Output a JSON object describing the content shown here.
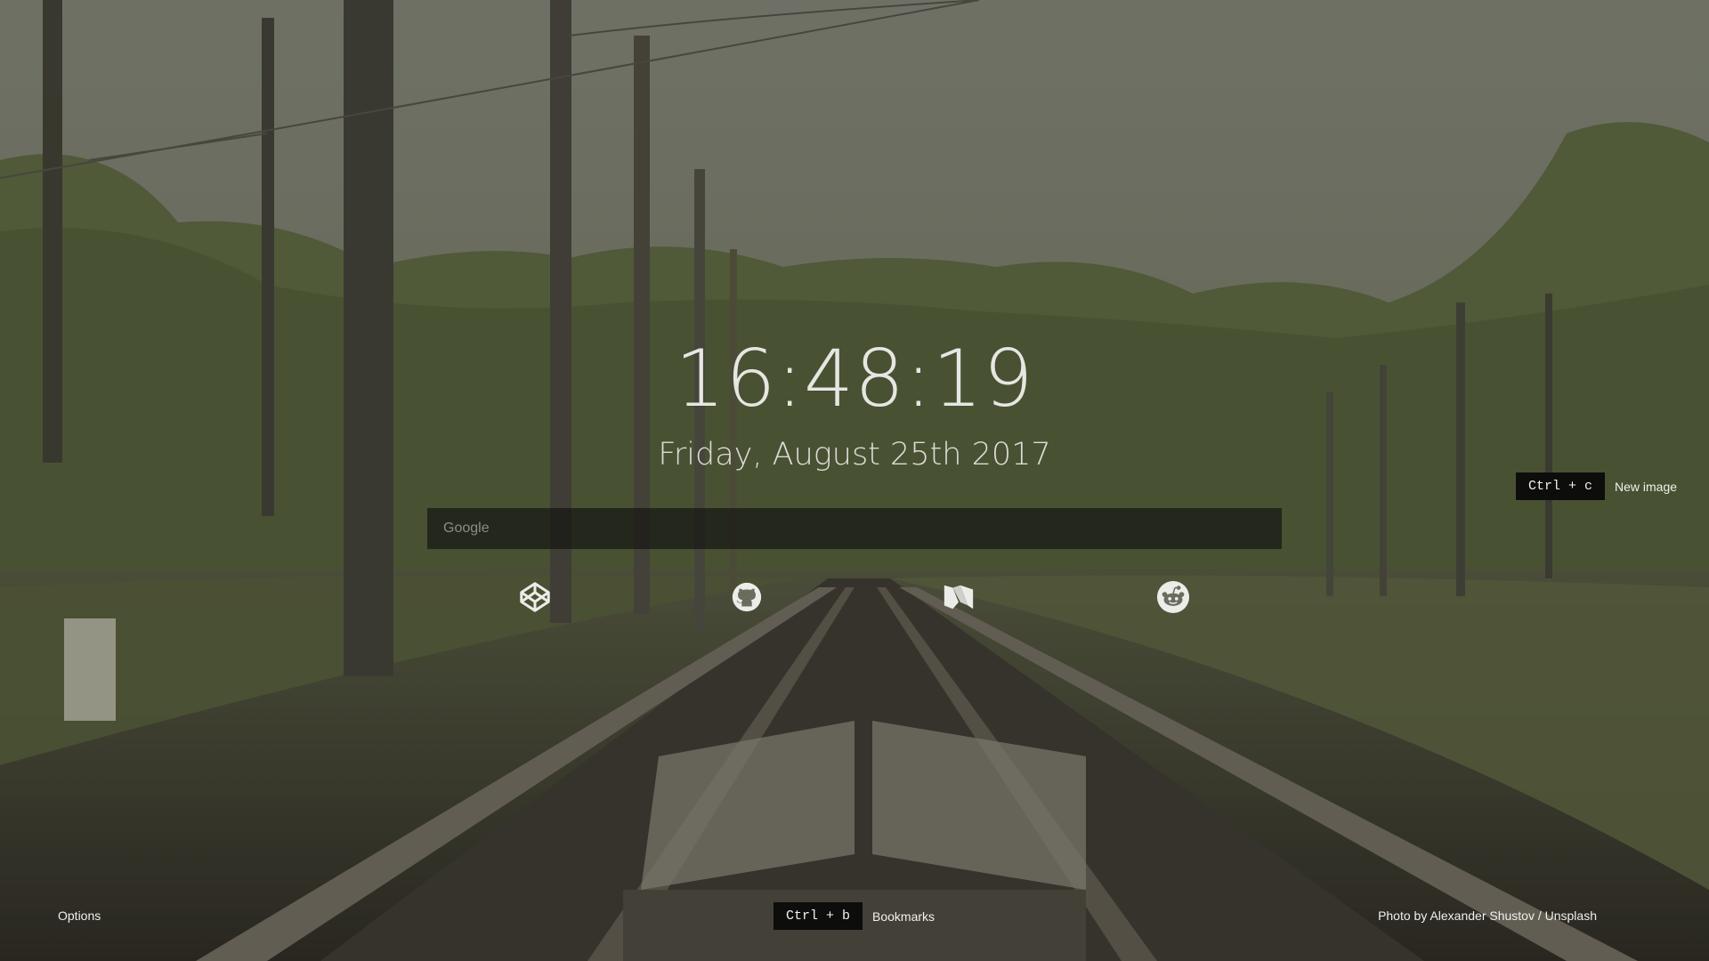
{
  "clock": {
    "time": "16:48:19",
    "date": "Friday, August 25th 2017"
  },
  "search": {
    "placeholder": "Google",
    "value": ""
  },
  "bookmarks": [
    {
      "name": "CodePen",
      "icon": "codepen-icon"
    },
    {
      "name": "GitHub",
      "icon": "github-icon"
    },
    {
      "name": "Medium",
      "icon": "medium-icon"
    },
    {
      "name": "Reddit",
      "icon": "reddit-icon"
    }
  ],
  "new_image": {
    "shortcut": "Ctrl + c",
    "label": "New image"
  },
  "bookmarks_toggle": {
    "shortcut": "Ctrl + b",
    "label": "Bookmarks"
  },
  "options": {
    "label": "Options"
  },
  "credit": {
    "text": "Photo by Alexander Shustov / Unsplash"
  },
  "colors": {
    "overlay_bar": "#16161290",
    "kbd_bg": "#0d0d0b",
    "text": "#f0f0ec"
  }
}
